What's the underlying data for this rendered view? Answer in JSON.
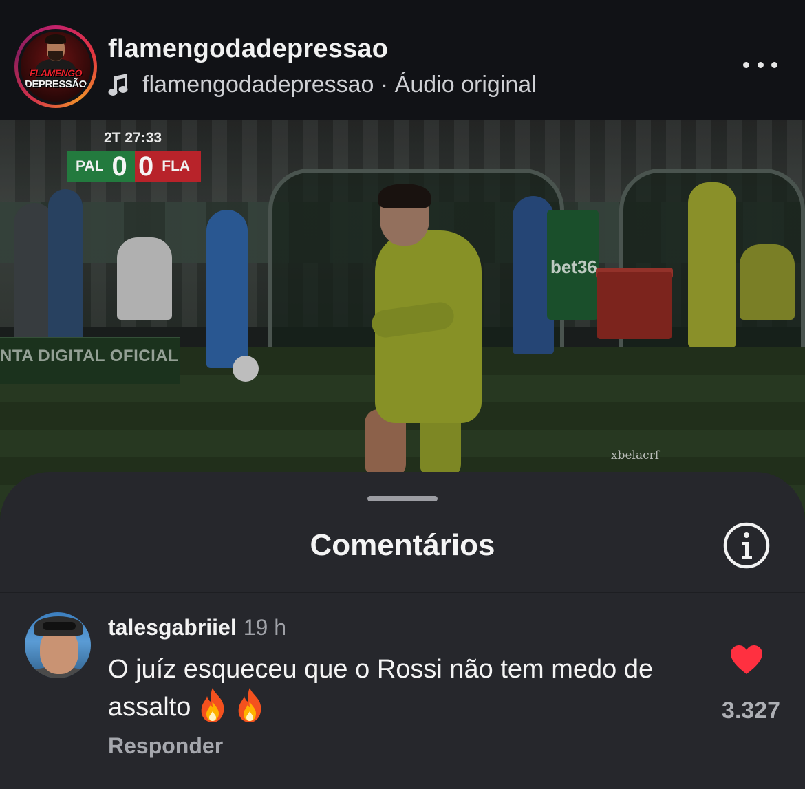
{
  "header": {
    "username": "flamengodadepressao",
    "audio": "flamengodadepressao · Áudio original",
    "avatar_text_top": "FLAMENGO",
    "avatar_text_bottom": "DEPRESSÃO",
    "ring_colors": [
      "#c4226b",
      "#e3363f",
      "#f0902a"
    ]
  },
  "video": {
    "scoreboard": {
      "time": "2T 27:33",
      "home_team": "PAL",
      "home_score": "0",
      "away_score": "0",
      "away_team": "FLA",
      "home_color": "#237a3e",
      "away_color": "#b8232a"
    },
    "adboard_text": "NTA DIGITAL OFICIAL",
    "sponsor_text": "bet36",
    "watermark": "xbelacrf"
  },
  "comments": {
    "title": "Comentários",
    "items": [
      {
        "username": "talesgabriiel",
        "time": "19 h",
        "text": "O juíz esqueceu que o Rossi não tem medo de assalto",
        "emoji": [
          "fire-icon",
          "fire-icon"
        ],
        "reply_label": "Responder",
        "like_count": "3.327",
        "liked": true,
        "heart_color": "#ff3040"
      }
    ]
  }
}
